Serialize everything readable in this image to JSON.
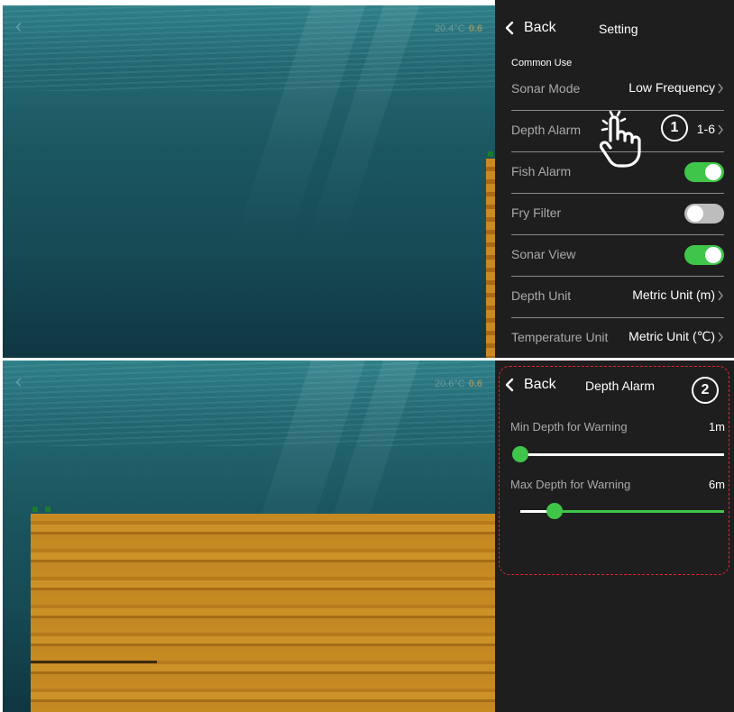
{
  "settings": {
    "back_label": "Back",
    "title": "Setting",
    "section": "Common Use",
    "rows": [
      {
        "label": "Sonar Mode",
        "value": "Low Frequency"
      },
      {
        "label": "Depth Alarm",
        "value": "1-6"
      },
      {
        "label": "Fish Alarm",
        "toggle": "on"
      },
      {
        "label": "Fry Filter",
        "toggle": "off"
      },
      {
        "label": "Sonar View",
        "toggle": "on"
      },
      {
        "label": "Depth Unit",
        "value": "Metric Unit (m)"
      },
      {
        "label": "Temperature Unit",
        "value": "Metric Unit (℃)"
      }
    ]
  },
  "sonar_top": {
    "temperature": "20.4°C",
    "depth": "0.6"
  },
  "sonar_bottom": {
    "temperature": "20.6°C",
    "depth": "0.6"
  },
  "depth_alarm": {
    "back_label": "Back",
    "title": "Depth Alarm",
    "min": {
      "label": "Min Depth for Warning",
      "value": "1m",
      "level": 0.0
    },
    "max": {
      "label": "Max Depth for Warning",
      "value": "6m",
      "level": 0.17
    }
  },
  "steps": {
    "one": "1",
    "two": "2"
  },
  "colors": {
    "panel_bg": "#1e1e1e",
    "accent_green": "#3fc64a",
    "toggle_off": "#bdbdbd",
    "highlight_dash": "#e0242e",
    "label_gray": "#a9a9a9"
  },
  "icons": {
    "back": "chevron-left-icon",
    "row_next": "chevron-right-icon",
    "hand": "hand-pointer-icon"
  }
}
